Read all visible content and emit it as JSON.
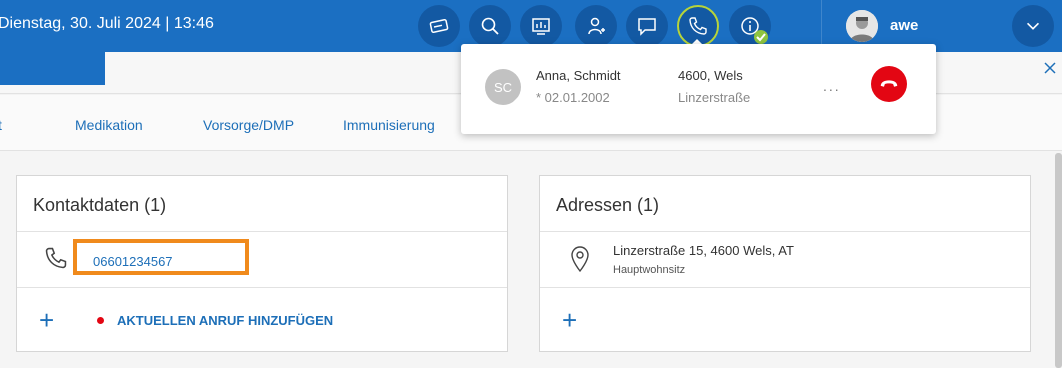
{
  "header": {
    "datetime": "Dienstag, 30. Juli 2024 | 13:46",
    "username": "awe",
    "icons": [
      "card-icon",
      "search-icon",
      "monitor-chart-icon",
      "add-person-icon",
      "chat-icon",
      "phone-icon",
      "info-icon"
    ],
    "accent_color": "#1b6fc2"
  },
  "tabs": {
    "partial": "t",
    "medikation": "Medikation",
    "vorsorge": "Vorsorge/DMP",
    "immunisierung": "Immunisierung"
  },
  "kontakt": {
    "title": "Kontaktdaten (1)",
    "phone": "06601234567",
    "add_call": "AKTUELLEN ANRUF HINZUFÜGEN"
  },
  "adressen": {
    "title": "Adressen (1)",
    "address": "Linzerstraße 15, 4600 Wels, AT",
    "type": "Hauptwohnsitz"
  },
  "call_popup": {
    "initials": "SC",
    "name": "Anna, Schmidt",
    "dob": "* 02.01.2002",
    "city": "4600, Wels",
    "street": "Linzerstraße",
    "more": "..."
  }
}
